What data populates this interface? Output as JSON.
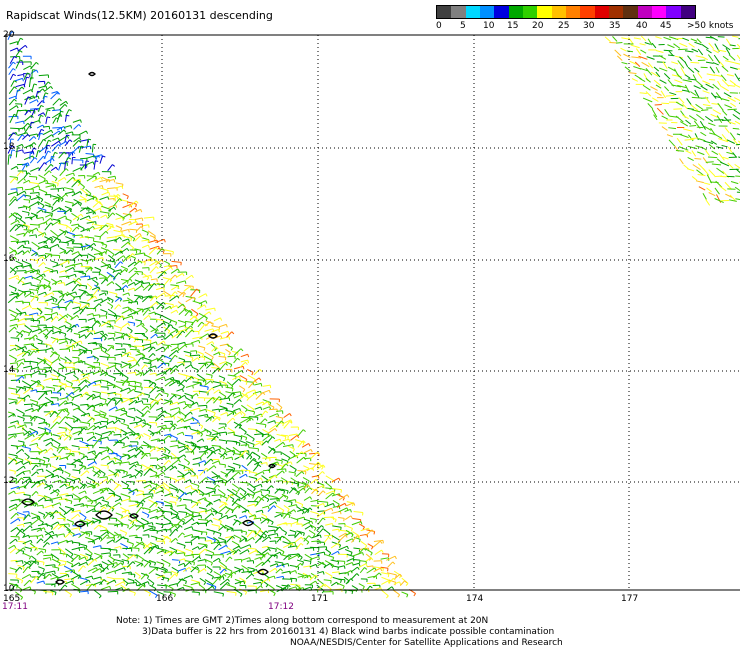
{
  "title": "Rapidscat Winds(12.5KM) 20160131 descending",
  "legend": {
    "colors": [
      "#404040",
      "#808080",
      "#00d8ff",
      "#0090ff",
      "#0000e0",
      "#00a800",
      "#30d000",
      "#ffff00",
      "#ffc000",
      "#ff8000",
      "#ff4000",
      "#e00000",
      "#a03000",
      "#603010",
      "#c000c0",
      "#ff00ff",
      "#8000ff",
      "#400080"
    ],
    "labels": [
      "0",
      "5",
      "10",
      "15",
      "20",
      "25",
      "30",
      "35",
      "40",
      "45",
      ">50 knots"
    ]
  },
  "map": {
    "x_ticks": [
      "165",
      "166",
      "171",
      "174",
      "177"
    ],
    "y_ticks": [
      "20",
      "18",
      "16",
      "14",
      "12",
      "10"
    ],
    "time_labels": [
      "17:11",
      "17:12"
    ],
    "grid_color": "#000000",
    "time_color": "#800080"
  },
  "notes": {
    "line1": "Note: 1) Times are GMT 2)Times along bottom correspond to measurement at 20N",
    "line2": "3)Data buffer is 22 hrs from 20160131 4) Black wind barbs indicate possible contamination",
    "line3": "NOAA/NESDIS/Center for Satellite Applications and Research"
  }
}
